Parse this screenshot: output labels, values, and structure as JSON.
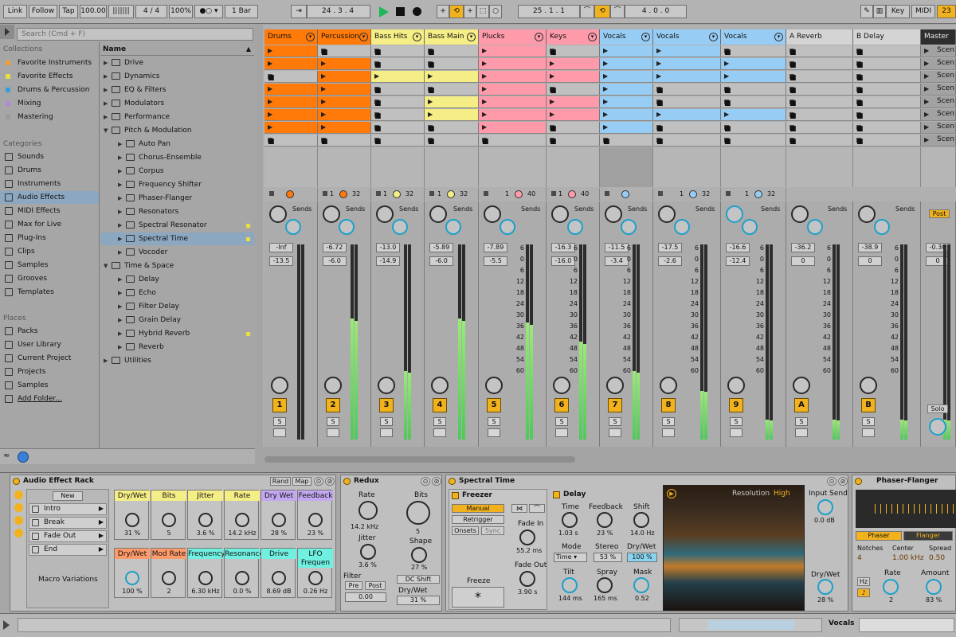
{
  "transport": {
    "link": "Link",
    "follow": "Follow",
    "tap": "Tap",
    "tempo": "100.00",
    "signature": "4 / 4",
    "zoom": "100%",
    "quantize": "1 Bar",
    "arr_pos": "24 . 3 . 4",
    "loop_pos": "25 . 1 . 1",
    "loop_len": "4 . 0 . 0",
    "key": "Key",
    "midi": "MIDI",
    "cpu": "23"
  },
  "browser": {
    "search_placeholder": "Search (Cmd + F)",
    "collections_title": "Collections",
    "collections": [
      {
        "label": "Favorite Instruments",
        "color": "#f0a030"
      },
      {
        "label": "Favorite Effects",
        "color": "#e8df40"
      },
      {
        "label": "Drums & Percussion",
        "color": "#3a9ed8"
      },
      {
        "label": "Mixing",
        "color": "#b08ad8"
      },
      {
        "label": "Mastering",
        "color": "#9a9a9a"
      }
    ],
    "categories_title": "Categories",
    "categories": [
      "Sounds",
      "Drums",
      "Instruments",
      "Audio Effects",
      "MIDI Effects",
      "Max for Live",
      "Plug-Ins",
      "Clips",
      "Samples",
      "Grooves",
      "Templates"
    ],
    "places_title": "Places",
    "places": [
      "Packs",
      "User Library",
      "Current Project",
      "Projects",
      "Samples",
      "Add Folder..."
    ],
    "name_header": "Name",
    "files": [
      {
        "label": "Drive",
        "level": 0
      },
      {
        "label": "Dynamics",
        "level": 0
      },
      {
        "label": "EQ & Filters",
        "level": 0
      },
      {
        "label": "Modulators",
        "level": 0
      },
      {
        "label": "Performance",
        "level": 0
      },
      {
        "label": "Pitch & Modulation",
        "level": 0
      },
      {
        "label": "Auto Pan",
        "level": 1
      },
      {
        "label": "Chorus-Ensemble",
        "level": 1
      },
      {
        "label": "Corpus",
        "level": 1
      },
      {
        "label": "Frequency Shifter",
        "level": 1
      },
      {
        "label": "Phaser-Flanger",
        "level": 1
      },
      {
        "label": "Resonators",
        "level": 1
      },
      {
        "label": "Spectral Resonator",
        "level": 1
      },
      {
        "label": "Spectral Time",
        "level": 1
      },
      {
        "label": "Vocoder",
        "level": 1
      },
      {
        "label": "Time & Space",
        "level": 0
      },
      {
        "label": "Delay",
        "level": 1
      },
      {
        "label": "Echo",
        "level": 1
      },
      {
        "label": "Filter Delay",
        "level": 1
      },
      {
        "label": "Grain Delay",
        "level": 1
      },
      {
        "label": "Hybrid Reverb",
        "level": 1
      },
      {
        "label": "Reverb",
        "level": 1
      },
      {
        "label": "Utilities",
        "level": 0
      }
    ]
  },
  "tracks": [
    {
      "name": "Drums",
      "color": "#ff7a08",
      "num": "1",
      "vol": "-Inf",
      "pan": "-13.5",
      "meter": 0,
      "clips": [
        1,
        1,
        0,
        1,
        1,
        1,
        1,
        0
      ]
    },
    {
      "name": "Percussion",
      "color": "#ff7a08",
      "num": "2",
      "vol": "-6.72",
      "pan": "-6.0",
      "meter": 0.62,
      "clips": [
        0,
        1,
        1,
        1,
        1,
        1,
        1,
        0
      ]
    },
    {
      "name": "Bass Hits",
      "color": "#f5ee86",
      "num": "3",
      "vol": "-13.0",
      "pan": "-14.9",
      "meter": 0.35,
      "clips": [
        0,
        0,
        1,
        0,
        0,
        0,
        0,
        0
      ]
    },
    {
      "name": "Bass Main",
      "color": "#f5ee86",
      "num": "4",
      "vol": "-5.89",
      "pan": "-6.0",
      "meter": 0.62,
      "clips": [
        0,
        0,
        1,
        0,
        1,
        1,
        0,
        0
      ]
    },
    {
      "name": "Plucks",
      "color": "#ff9aaa",
      "num": "5",
      "vol": "-7.89",
      "pan": "-5.5",
      "meter": 0.6,
      "clips": [
        1,
        1,
        1,
        1,
        1,
        1,
        1,
        0
      ]
    },
    {
      "name": "Keys",
      "color": "#ff9aaa",
      "num": "6",
      "vol": "-16.3",
      "pan": "-16.0",
      "meter": 0.5,
      "clips": [
        0,
        1,
        1,
        0,
        1,
        1,
        0,
        0
      ]
    },
    {
      "name": "Vocals",
      "color": "#97cdf5",
      "num": "7",
      "vol": "-11.5",
      "pan": "-3.4",
      "meter": 0.35,
      "clips": [
        1,
        1,
        1,
        1,
        1,
        1,
        1,
        0
      ]
    },
    {
      "name": "Vocals",
      "color": "#97cdf5",
      "num": "8",
      "vol": "-17.5",
      "pan": "-2.6",
      "meter": 0.25,
      "clips": [
        1,
        1,
        1,
        0,
        0,
        1,
        0,
        0
      ]
    },
    {
      "name": "Vocals",
      "color": "#97cdf5",
      "num": "9",
      "vol": "-16.6",
      "pan": "-12.4",
      "meter": 0.1,
      "clips": [
        0,
        1,
        1,
        0,
        0,
        1,
        0,
        0
      ]
    },
    {
      "name": "A Reverb",
      "color": "#d4d4d4",
      "num": "A",
      "vol": "-36.2",
      "pan": "0",
      "meter": 0.1,
      "clips": [
        0,
        0,
        0,
        0,
        0,
        0,
        0,
        0
      ]
    },
    {
      "name": "B Delay",
      "color": "#d4d4d4",
      "num": "B",
      "vol": "-38.9",
      "pan": "0",
      "meter": 0.1,
      "clips": [
        0,
        0,
        0,
        0,
        0,
        0,
        0,
        0
      ]
    },
    {
      "name": "Master",
      "color": "#2e2e2e",
      "num": "",
      "vol": "-0.30",
      "pan": "0",
      "meter": 0.1,
      "clips": [
        0,
        0,
        0,
        0,
        0,
        0,
        0,
        0
      ]
    }
  ],
  "scene_label": "Scen",
  "sends_label": "Sends",
  "post_label": "Post",
  "solo_label": "Solo",
  "s_label": "S",
  "db_scale": [
    "6",
    "0",
    "6",
    "12",
    "18",
    "24",
    "30",
    "36",
    "42",
    "48",
    "54",
    "60"
  ],
  "clip_counts": [
    [
      "",
      ""
    ],
    [
      "1",
      "32"
    ],
    [
      "1",
      "32"
    ],
    [
      "1",
      "32"
    ],
    [
      "1",
      "40"
    ],
    [
      "1",
      "40"
    ],
    [
      "",
      ""
    ],
    [
      "1",
      "32"
    ],
    [
      "1",
      "32"
    ]
  ],
  "rack": {
    "title": "Audio Effect Rack",
    "rand": "Rand",
    "map": "Map",
    "new": "New",
    "variations": [
      "Intro",
      "Break",
      "Fade Out",
      "End"
    ],
    "var_label": "Macro Variations",
    "macros": [
      {
        "name": "Dry/Wet",
        "value": "31 %",
        "color": "#f5ee86"
      },
      {
        "name": "Bits",
        "value": "5",
        "color": "#f5ee86"
      },
      {
        "name": "Jitter",
        "value": "3.6 %",
        "color": "#f5ee86"
      },
      {
        "name": "Rate",
        "value": "14.2 kHz",
        "color": "#f5ee86"
      },
      {
        "name": "Dry Wet",
        "value": "28 %",
        "color": "#c3a8f0"
      },
      {
        "name": "Feedback",
        "value": "23 %",
        "color": "#c3a8f0"
      },
      {
        "name": "Dry/Wet",
        "value": "100 %",
        "color": "#ff9a6a"
      },
      {
        "name": "Mod Rate",
        "value": "2",
        "color": "#ff9a6a"
      },
      {
        "name": "Frequency",
        "value": "6.30 kHz",
        "color": "#6ff0e0"
      },
      {
        "name": "Resonance",
        "value": "0.0 %",
        "color": "#6ff0e0"
      },
      {
        "name": "Drive",
        "value": "8.69 dB",
        "color": "#6ff0e0"
      },
      {
        "name": "LFO Frequen",
        "value": "0.26 Hz",
        "color": "#6ff0e0"
      }
    ]
  },
  "redux": {
    "title": "Redux",
    "rate_label": "Rate",
    "rate_val": "14.2 kHz",
    "bits_label": "Bits",
    "bits_val": "5",
    "jitter_label": "Jitter",
    "jitter_val": "3.6 %",
    "shape_label": "Shape",
    "shape_val": "27 %",
    "filter_label": "Filter",
    "pre": "Pre",
    "post": "Post",
    "filter_val": "0.00",
    "dc": "DC Shift",
    "drywet_label": "Dry/Wet",
    "drywet_val": "31 %"
  },
  "spectral": {
    "title": "Spectral Time",
    "freezer": "Freezer",
    "manual": "Manual",
    "retrigger": "Retrigger",
    "onsets": "Onsets",
    "sync": "Sync",
    "fadein_label": "Fade In",
    "fadein_val": "55.2 ms",
    "fadeout_label": "Fade Out",
    "fadeout_val": "3.90 s",
    "freeze": "Freeze",
    "freeze_sym": "*",
    "delay": "Delay",
    "time_label": "Time",
    "time_val": "1.03 s",
    "feedback_label": "Feedback",
    "feedback_val": "23 %",
    "shift_label": "Shift",
    "shift_val": "14.0 Hz",
    "mode_label": "Mode",
    "mode_val": "Time",
    "stereo_label": "Stereo",
    "stereo_val": "53 %",
    "drywet_label": "Dry/Wet",
    "drywet_val": "100 %",
    "tilt_label": "Tilt",
    "tilt_val": "144 ms",
    "spray_label": "Spray",
    "spray_val": "165 ms",
    "mask_label": "Mask",
    "mask_val": "0.52",
    "res_label": "Resolution",
    "res_val": "High",
    "input_send_label": "Input Send",
    "input_send_val": "0.0 dB",
    "drywet2_label": "Dry/Wet",
    "drywet2_val": "28 %"
  },
  "phaser": {
    "title": "Phaser-Flanger",
    "phaser": "Phaser",
    "flanger": "Flanger",
    "notches_label": "Notches",
    "notches_val": "4",
    "center_label": "Center",
    "center_val": "1.00 kHz",
    "spread_label": "Spread",
    "spread_val": "0.50",
    "rate_label": "Rate",
    "rate_val": "2",
    "amount_label": "Amount",
    "amount_val": "83 %",
    "hz": "Hz"
  },
  "footer": {
    "track_label": "Vocals"
  }
}
